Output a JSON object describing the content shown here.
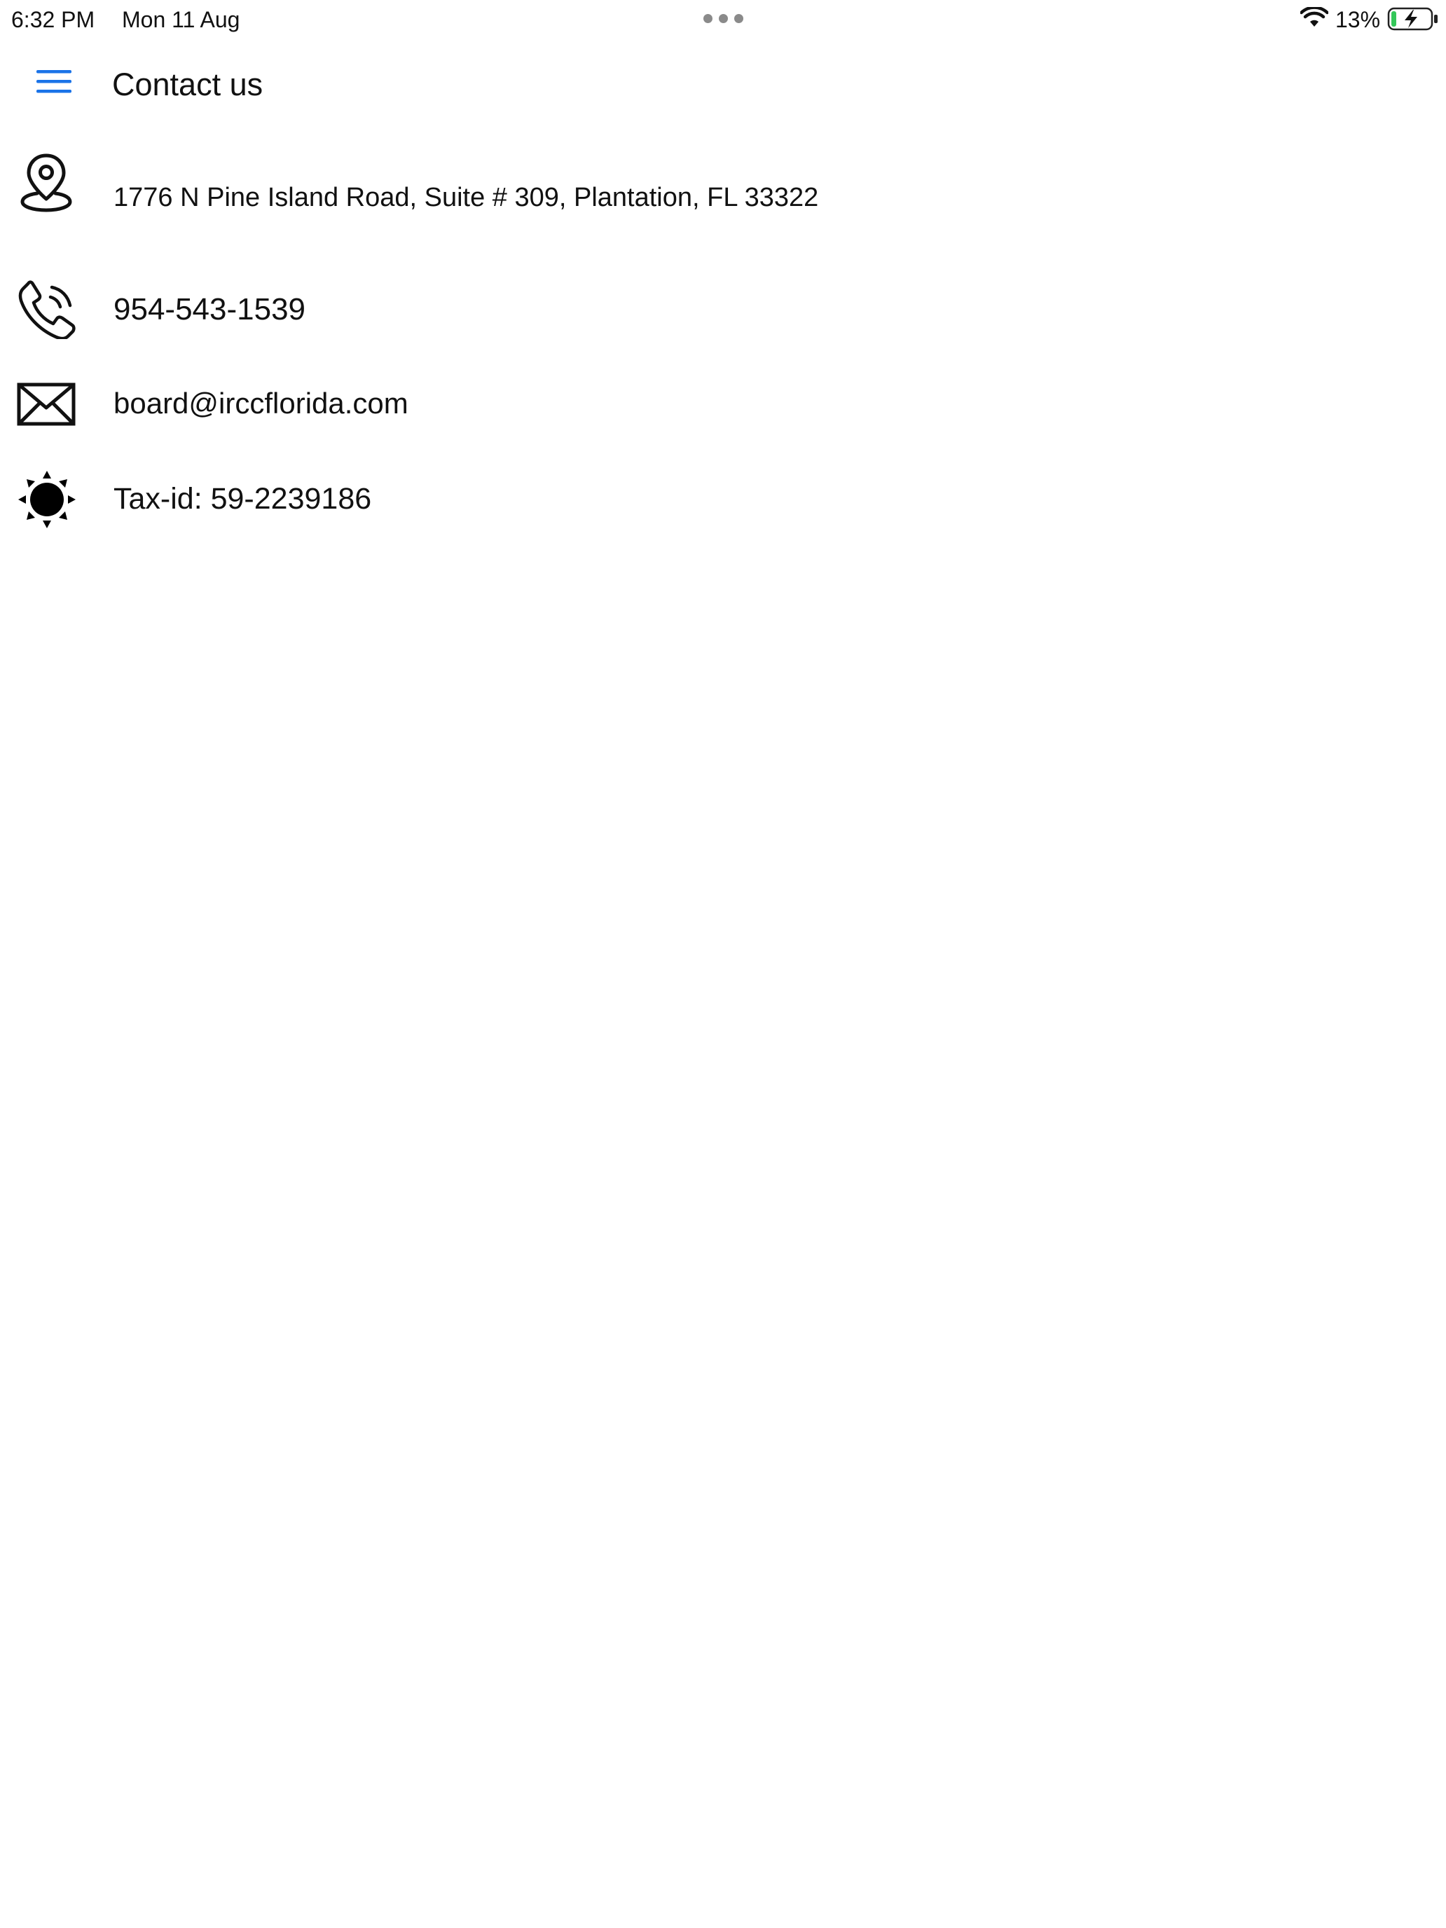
{
  "status_bar": {
    "time": "6:32 PM",
    "date": "Mon 11 Aug",
    "battery_percent": "13%",
    "battery_level": 0.13,
    "battery_charging": true,
    "icons": [
      "more-dots-icon",
      "wifi-icon",
      "battery-charging-icon"
    ]
  },
  "header": {
    "menu_icon": "hamburger-menu-icon",
    "title": "Contact us"
  },
  "contacts": {
    "address": {
      "icon": "location-pin-icon",
      "text": "1776 N Pine Island Road, Suite # 309, Plantation, FL 33322"
    },
    "phone": {
      "icon": "phone-icon",
      "text": "954-543-1539"
    },
    "email": {
      "icon": "envelope-icon",
      "text": "board@irccflorida.com"
    },
    "tax": {
      "icon": "sun-icon",
      "text": "Tax-id: 59-2239186"
    }
  },
  "colors": {
    "accent": "#1a73e8",
    "text": "#111111",
    "background": "#ffffff",
    "battery_fill": "#34c759"
  }
}
